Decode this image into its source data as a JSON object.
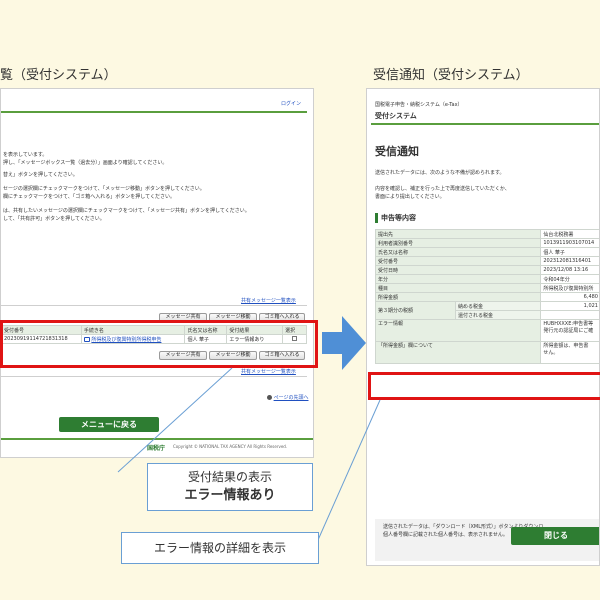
{
  "left": {
    "heading": "覧（受付システム）",
    "logout": "ログイン",
    "instructions": [
      "を表示しています。",
      "押し、「メッセージボックス一覧（過去分）」画面より確認してください。",
      "替え」ボタンを押してください。",
      "セージの選択欄にチェックマークをつけて、「メッセージ移動」ボタンを押してください。",
      "欄にチェックマークをつけて、「ゴミ箱へ入れる」ボタンを押してください。",
      "は、共有したいメッセージの選択欄にチェックマークをつけて、「メッセージ共有」ボタンを押してください。",
      "して、「共有許可」ボタンを押してください。"
    ],
    "shared_link": "共有メッセージ一覧表示",
    "buttons": {
      "share": "メッセージ共有",
      "move": "メッセージ移動",
      "trash": "ゴミ箱へ入れる"
    },
    "table": {
      "headers": [
        "受付番号",
        "手続き名",
        "氏名又は名称",
        "受付結果",
        "選択"
      ],
      "row": [
        "20230919114721831318",
        "所得税及び復興特別所得税申告",
        "個人 華子",
        "エラー情報あり",
        ""
      ]
    },
    "page_top": "ページの先頭へ",
    "menu_back": "メニューに戻る",
    "agency": "国税庁",
    "copyright": "Copyright © NATIONAL TAX AGENCY All Rights Reserved."
  },
  "right": {
    "heading": "受信通知（受付システム）",
    "system_top": "国税電子申告・納税システム（e-Tax）",
    "system_name": "受付システム",
    "title": "受信通知",
    "intro": [
      "送信されたデータには、次のような不備が認められます。",
      "内容を確認し、補正を行った上で再度送信していただくか、",
      "書面により提出してください。"
    ],
    "section_title": "申告等内容",
    "rows": [
      {
        "label": "提出先",
        "value": "仙台北税務署"
      },
      {
        "label": "利用者識別番号",
        "value": "1013911903107014"
      },
      {
        "label": "氏名又は名称",
        "value": "個人 華子"
      },
      {
        "label": "受付番号",
        "value": "202312081316401"
      },
      {
        "label": "受付日時",
        "value": "2023/12/08 13:16"
      },
      {
        "label": "年分",
        "value": "令和04年分"
      },
      {
        "label": "種目",
        "value": "所得税及び復興特別所"
      },
      {
        "label": "所得金額",
        "value": "6,480"
      }
    ],
    "tax_label": "第３期分の税額",
    "tax_sub1": "納める税金",
    "tax_sub2": "還付される税金",
    "tax_value": "1,021",
    "error_label": "エラー情報",
    "error_value": [
      "HUBHXXXE:申告書等",
      "発行元の認証局にご確"
    ],
    "shotoku_label": "「所得金額」欄について",
    "shotoku_value": [
      "所得金額は、申告書",
      "せん。"
    ],
    "note": [
      "送信されたデータは、「ダウンロード（XML形式）」ボタンよりダウンロ",
      "個人番号欄に記載された個人番号は、表示されません。"
    ],
    "close": "閉じる"
  },
  "callouts": {
    "result_line1": "受付結果の表示",
    "result_line2": "エラー情報あり",
    "detail": "エラー情報の詳細を表示"
  },
  "colors": {
    "error_red": "#e01414",
    "arrow_blue": "#4f8fd6",
    "button_green": "#2e7d32",
    "background": "#fdf9e2"
  }
}
